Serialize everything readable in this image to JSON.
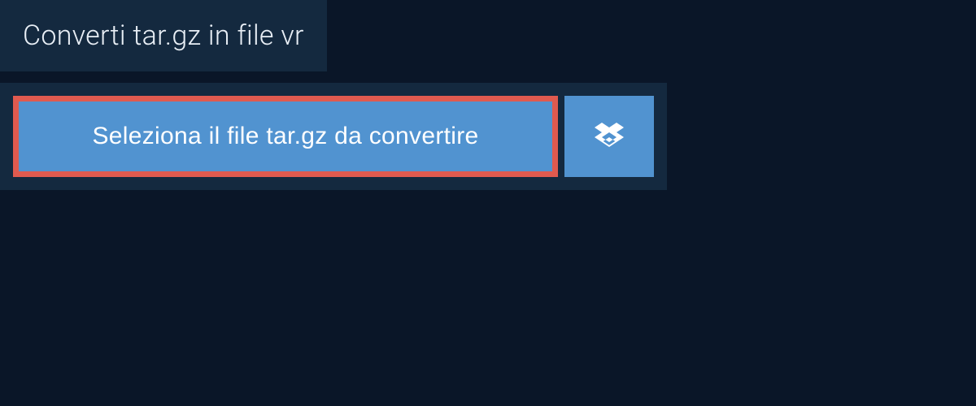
{
  "header": {
    "title": "Converti tar.gz in file vr"
  },
  "upload": {
    "select_label": "Seleziona il file tar.gz da convertire"
  },
  "colors": {
    "background": "#0a1628",
    "panel": "#14293f",
    "button": "#5193d0",
    "highlight_border": "#e05a4f",
    "text_light": "#e8eef5",
    "text_white": "#ffffff"
  }
}
